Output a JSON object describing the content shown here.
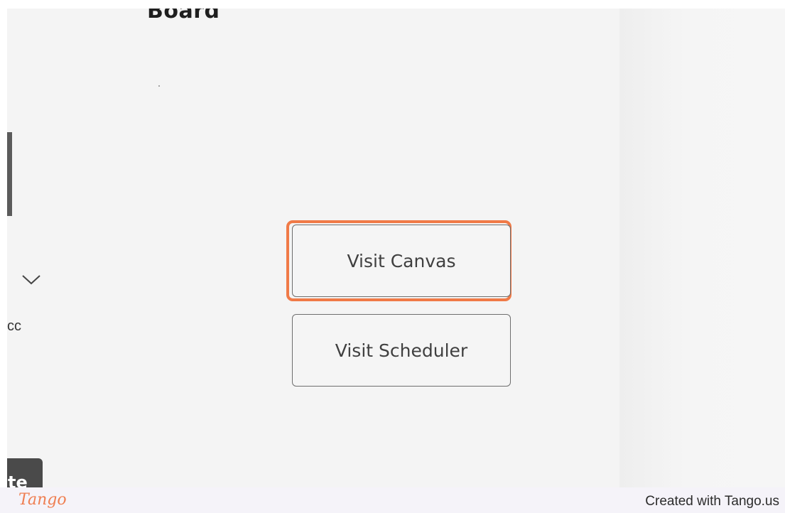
{
  "page": {
    "board_title": "Board",
    "partial_text": "cc",
    "dark_button_text": "te"
  },
  "buttons": {
    "visit_canvas": "Visit Canvas",
    "visit_scheduler": "Visit Scheduler"
  },
  "footer": {
    "logo_text": "Tango",
    "credit": "Created with Tango.us"
  },
  "icons": {
    "chevron": "chevron-down-icon"
  },
  "colors": {
    "highlight": "#f07a47",
    "logo": "#ef7f52",
    "background": "#f4f4f4",
    "footer_bg": "#f5f3f9"
  }
}
